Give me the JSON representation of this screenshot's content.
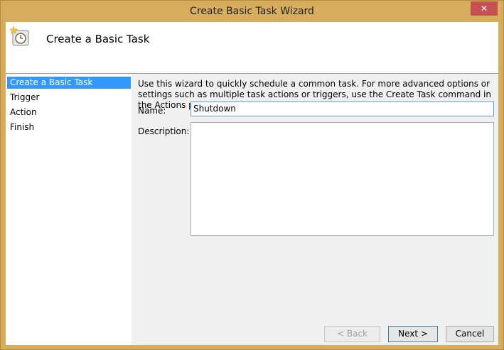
{
  "window": {
    "title": "Create Basic Task Wizard",
    "close_label": "✕"
  },
  "header": {
    "title": "Create a Basic Task",
    "icon": "scheduled-task-clock-icon"
  },
  "sidebar": {
    "steps": [
      {
        "label": "Create a Basic Task",
        "active": true
      },
      {
        "label": "Trigger",
        "active": false
      },
      {
        "label": "Action",
        "active": false
      },
      {
        "label": "Finish",
        "active": false
      }
    ]
  },
  "main": {
    "intro": "Use this wizard to quickly schedule a common task.  For more advanced options or settings such as multiple task actions or triggers, use the Create Task command in the Actions pane.",
    "name_label": "Name:",
    "name_value": "Shutdown",
    "description_label": "Description:",
    "description_value": ""
  },
  "buttons": {
    "back": "< Back",
    "next": "Next >",
    "cancel": "Cancel"
  },
  "colors": {
    "frame": "#d7ae5d",
    "selection": "#3399ff",
    "close": "#c75050"
  }
}
